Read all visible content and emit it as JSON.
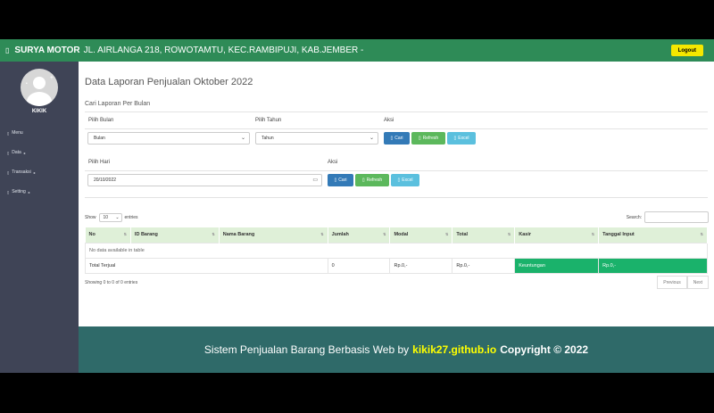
{
  "topbar": {
    "brand": "SURYA MOTOR",
    "address": "JL. AIRLANGA 218, ROWOTAMTU, KEC.RAMBIPUJI, KAB.JEMBER -",
    "logout_label": "Logout"
  },
  "sidebar": {
    "username": "KIKIK",
    "items": [
      {
        "label": "Menu",
        "suffix": ""
      },
      {
        "label": "Data",
        "suffix": "▸"
      },
      {
        "label": "Transaksi",
        "suffix": "▸"
      },
      {
        "label": "Setting",
        "suffix": "▸"
      }
    ]
  },
  "main": {
    "title": "Data Laporan Penjualan Oktober 2022",
    "subtitle": "Cari Laporan Per Bulan",
    "month_form": {
      "month_label": "Pilih Bulan",
      "month_value": "Bulan",
      "year_label": "Pilih Tahun",
      "year_value": "Tahun",
      "action_label": "Aksi",
      "search_label": "Cari",
      "refresh_label": "Refresh",
      "excel_label": "Excel"
    },
    "day_form": {
      "day_label": "Pilih Hari",
      "day_value": "20/10/2022",
      "action_label": "Aksi",
      "search_label": "Cari",
      "refresh_label": "Refresh",
      "excel_label": "Excel"
    },
    "table_controls": {
      "show_label": "Show",
      "length_value": "10",
      "entries_label": "entries",
      "search_label": "Search:"
    },
    "table": {
      "columns": [
        "No",
        "ID Barang",
        "Nama Barang",
        "Jumlah",
        "Modal",
        "Total",
        "Kasir",
        "Tanggal Input"
      ],
      "empty_message": "No data available in table",
      "total_label": "Total Terjual",
      "total_jumlah": "0",
      "total_modal": "Rp.0,-",
      "total_total": "Rp.0,-",
      "keuntungan_label": "Keuntungan",
      "keuntungan_value": "Rp.0,-"
    },
    "info": "Showing 0 to 0 of 0 entries",
    "pager": {
      "previous": "Previous",
      "next": "Next"
    }
  },
  "footer": {
    "text": "Sistem Penjualan Barang Berbasis Web by",
    "link": "kikik27.github.io",
    "copyright": "Copyright © 2022"
  },
  "colors": {
    "topbar": "#2e8b57",
    "sidebar": "#3f4456",
    "footer": "#2f6a69",
    "logout": "#f5e700",
    "keuntungan": "#1ab26b"
  }
}
